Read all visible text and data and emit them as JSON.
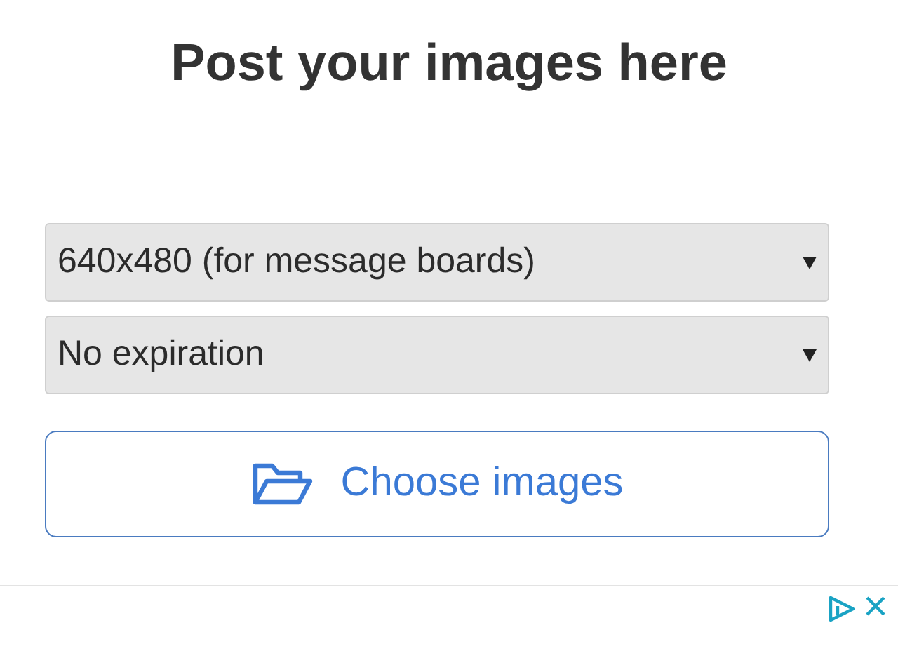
{
  "heading": "Post your images here",
  "selects": [
    {
      "value": "640x480 (for message boards)"
    },
    {
      "value": "No expiration"
    }
  ],
  "upload_button": {
    "label": "Choose images"
  },
  "ad_bar": {
    "closable": true
  }
}
